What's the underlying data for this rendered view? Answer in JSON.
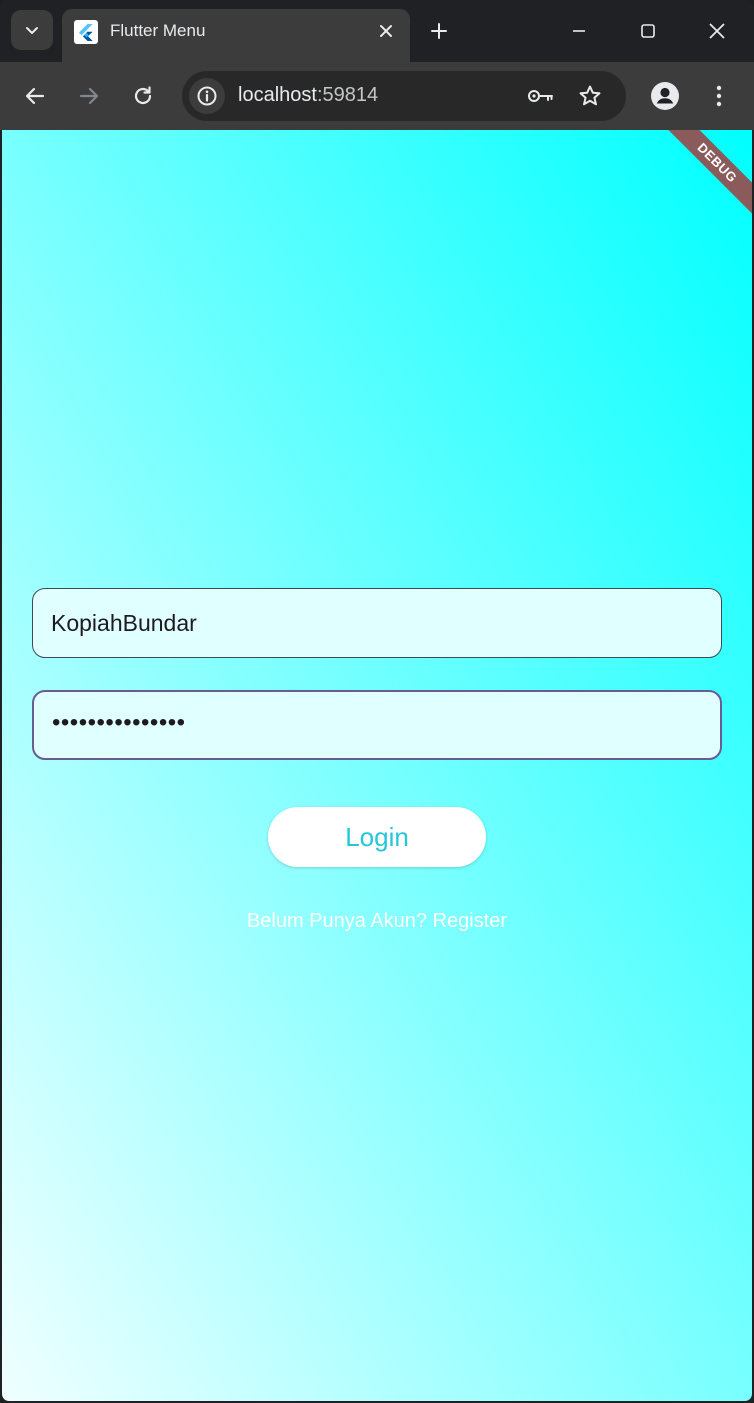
{
  "browser": {
    "tab": {
      "title": "Flutter Menu",
      "favicon": "flutter-logo-icon"
    },
    "address_bar": {
      "host": "localhost",
      "port": ":59814"
    },
    "icons": {
      "tab_search": "chevron-down-icon",
      "close_tab": "close-icon",
      "new_tab": "plus-icon",
      "minimize": "minimize-icon",
      "maximize": "maximize-icon",
      "close_window": "close-icon",
      "back": "back-arrow-icon",
      "forward": "forward-arrow-icon",
      "reload": "reload-icon",
      "site_info": "info-icon",
      "passwords": "key-icon",
      "bookmark": "star-icon",
      "profile": "person-icon",
      "menu": "kebab-menu-icon"
    }
  },
  "app": {
    "debug_banner": "DEBUG",
    "username_field": {
      "value": "KopiahBundar"
    },
    "password_field": {
      "value": "•••••••••••••••"
    },
    "login_button": "Login",
    "register_link": "Belum Punya Akun? Register",
    "colors": {
      "gradient_start": "#F0FFFF",
      "gradient_end": "#00FFFF",
      "field_fill": "#E0FFFF",
      "button_text": "#26C6DA",
      "focused_border": "#6B5B95"
    }
  }
}
